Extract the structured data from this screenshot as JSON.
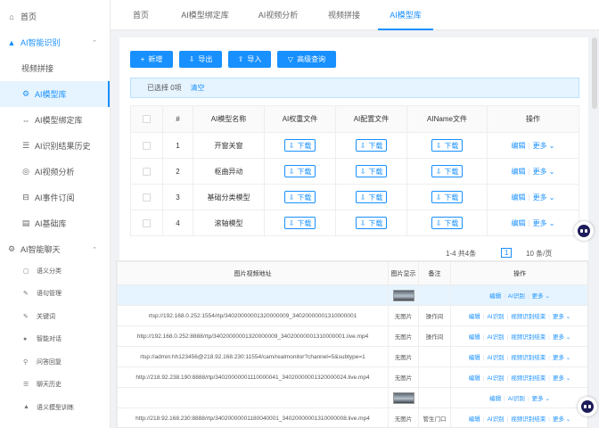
{
  "sidebar": {
    "items": [
      {
        "label": "首页",
        "icon": "home-icon",
        "glyph": "⌂"
      },
      {
        "label": "AI智能识别",
        "icon": "triangle-icon",
        "glyph": "▲"
      },
      {
        "label": "视频拼接",
        "icon": "",
        "glyph": ""
      },
      {
        "label": "AI模型库",
        "icon": "gear-icon",
        "glyph": "⚙"
      },
      {
        "label": "AI模型绑定库",
        "icon": "bind-icon",
        "glyph": "⇔"
      },
      {
        "label": "AI识别结果历史",
        "icon": "list-icon",
        "glyph": "☰"
      },
      {
        "label": "AI视频分析",
        "icon": "analysis-icon",
        "glyph": "◎"
      },
      {
        "label": "AI事件订阅",
        "icon": "subscribe-icon",
        "glyph": "⊟"
      },
      {
        "label": "AI基础库",
        "icon": "document-icon",
        "glyph": "▤"
      },
      {
        "label": "AI智能聊天",
        "icon": "chat-gear-icon",
        "glyph": "⚙"
      }
    ],
    "collapse_glyph": "⌃"
  },
  "lower_sidebar": {
    "items": [
      {
        "label": "语义分类",
        "glyph": "▢"
      },
      {
        "label": "语句管理",
        "glyph": "✎"
      },
      {
        "label": "关键词",
        "glyph": "✎"
      },
      {
        "label": "智能对话",
        "glyph": "●"
      },
      {
        "label": "问答回复",
        "glyph": "⚲"
      },
      {
        "label": "聊天历史",
        "glyph": "☰"
      },
      {
        "label": "语义模型训练",
        "glyph": "▲"
      }
    ]
  },
  "tabs": [
    "首页",
    "AI模型绑定库",
    "AI视频分析",
    "视频拼接",
    "AI模型库"
  ],
  "toolbar": {
    "add": "新增",
    "add_glyph": "+",
    "export": "导出",
    "export_glyph": "⇩",
    "import": "导入",
    "import_glyph": "⇪",
    "query": "高级查询",
    "query_glyph": "▽"
  },
  "selection": {
    "text": "已选择 0项",
    "clear": "清空"
  },
  "table": {
    "headers": [
      "#",
      "AI模型名称",
      "AI权重文件",
      "AI配置文件",
      "AIName文件",
      "操作"
    ],
    "rows": [
      {
        "num": "1",
        "name": "开窗关窗"
      },
      {
        "num": "2",
        "name": "枢曲异动"
      },
      {
        "num": "3",
        "name": "基础分类模型"
      },
      {
        "num": "4",
        "name": "滚轴模型"
      }
    ],
    "download": "下载",
    "download_glyph": "⇩",
    "edit": "编辑",
    "more": "更多 ⌄"
  },
  "pager": {
    "total": "1-4 共4条",
    "page": "1",
    "size": "10 条/页"
  },
  "lower_table": {
    "headers": [
      "图片视频地址",
      "图片显示",
      "备注",
      "操作"
    ],
    "rows": [
      {
        "url": "",
        "img": "thumb",
        "note": "",
        "actions": [
          "编辑",
          "AI识别",
          "更多 ⌄"
        ],
        "highlight": true
      },
      {
        "url": "rtsp://192.168.0.252:1554/rtp/34020000001320000009_34020000001310000001",
        "img": "无图片",
        "note": "操作间",
        "actions": [
          "编辑",
          "AI识别",
          "视频识别结束",
          "更多 ⌄"
        ],
        "highlight": false
      },
      {
        "url": "http://192.168.0.252:8888/rtp/34020000001320000009_34020000001310000001.live.mp4",
        "img": "无图片",
        "note": "操作间",
        "actions": [
          "编辑",
          "AI识别",
          "视频识别结束",
          "更多 ⌄"
        ],
        "highlight": false
      },
      {
        "url": "rtsp://admin:hh123456@218.92.168.230:11554/cam/realmonitor?channel=5&subtype=1",
        "img": "无图片",
        "note": "",
        "actions": [
          "编辑",
          "AI识别",
          "视频识别结束",
          "更多 ⌄"
        ],
        "highlight": false
      },
      {
        "url": "http://218.92.238.190:8888/rtp/34020000001110000041_34020000001320000024.live.mp4",
        "img": "无图片",
        "note": "",
        "actions": [
          "编辑",
          "AI识别",
          "视频识别结束",
          "更多 ⌄"
        ],
        "highlight": false
      },
      {
        "url": "",
        "img": "thumb",
        "note": "",
        "actions": [
          "编辑",
          "AI识别",
          "更多 ⌄"
        ],
        "highlight": false
      },
      {
        "url": "http://218.92.168.230:8888/rtp/34020000001180040001_34020000001310000008.live.mp4",
        "img": "无图片",
        "note": "管生门口",
        "actions": [
          "编辑",
          "AI识别",
          "视频识别结束",
          "更多 ⌄"
        ],
        "highlight": false
      }
    ]
  },
  "colors": {
    "accent": "#1890ff",
    "active_bg": "#e6f4ff"
  }
}
